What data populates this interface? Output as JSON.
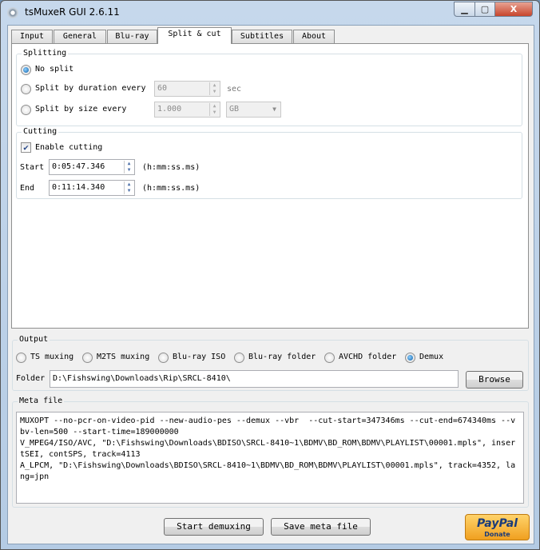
{
  "window": {
    "title": "tsMuxeR GUI 2.6.11",
    "minimize": "▁",
    "maximize": "▢",
    "close": "X"
  },
  "tabs": [
    {
      "label": "Input"
    },
    {
      "label": "General"
    },
    {
      "label": "Blu-ray"
    },
    {
      "label": "Split & cut",
      "active": true
    },
    {
      "label": "Subtitles"
    },
    {
      "label": "About"
    }
  ],
  "splitting": {
    "title": "Splitting",
    "no_split": "No split",
    "by_duration": "Split by duration every",
    "duration_value": "60",
    "duration_unit": "sec",
    "by_size": "Split by size every",
    "size_value": "1.000",
    "size_unit": "GB",
    "selected": "no_split"
  },
  "cutting": {
    "title": "Cutting",
    "enable_label": "Enable cutting",
    "enabled": true,
    "start_label": "Start",
    "start_value": "0:05:47.346",
    "end_label": "End",
    "end_value": "0:11:14.340",
    "format_hint": "(h:mm:ss.ms)"
  },
  "output": {
    "title": "Output",
    "options": [
      "TS muxing",
      "M2TS muxing",
      "Blu-ray ISO",
      "Blu-ray folder",
      "AVCHD folder",
      "Demux"
    ],
    "selected": "Demux",
    "folder_label": "Folder",
    "folder_value": "D:\\Fishswing\\Downloads\\Rip\\SRCL-8410\\",
    "browse": "Browse"
  },
  "meta": {
    "title": "Meta file",
    "text": "MUXOPT --no-pcr-on-video-pid --new-audio-pes --demux --vbr  --cut-start=347346ms --cut-end=674340ms --vbv-len=500 --start-time=189000000\nV_MPEG4/ISO/AVC, \"D:\\Fishswing\\Downloads\\BDISO\\SRCL-8410~1\\BDMV\\BD_ROM\\BDMV\\PLAYLIST\\00001.mpls\", insertSEI, contSPS, track=4113\nA_LPCM, \"D:\\Fishswing\\Downloads\\BDISO\\SRCL-8410~1\\BDMV\\BD_ROM\\BDMV\\PLAYLIST\\00001.mpls\", track=4352, lang=jpn"
  },
  "actions": {
    "start": "Start demuxing",
    "save": "Save meta file"
  },
  "paypal": {
    "brand": "PayPal",
    "sub": "Donate"
  }
}
